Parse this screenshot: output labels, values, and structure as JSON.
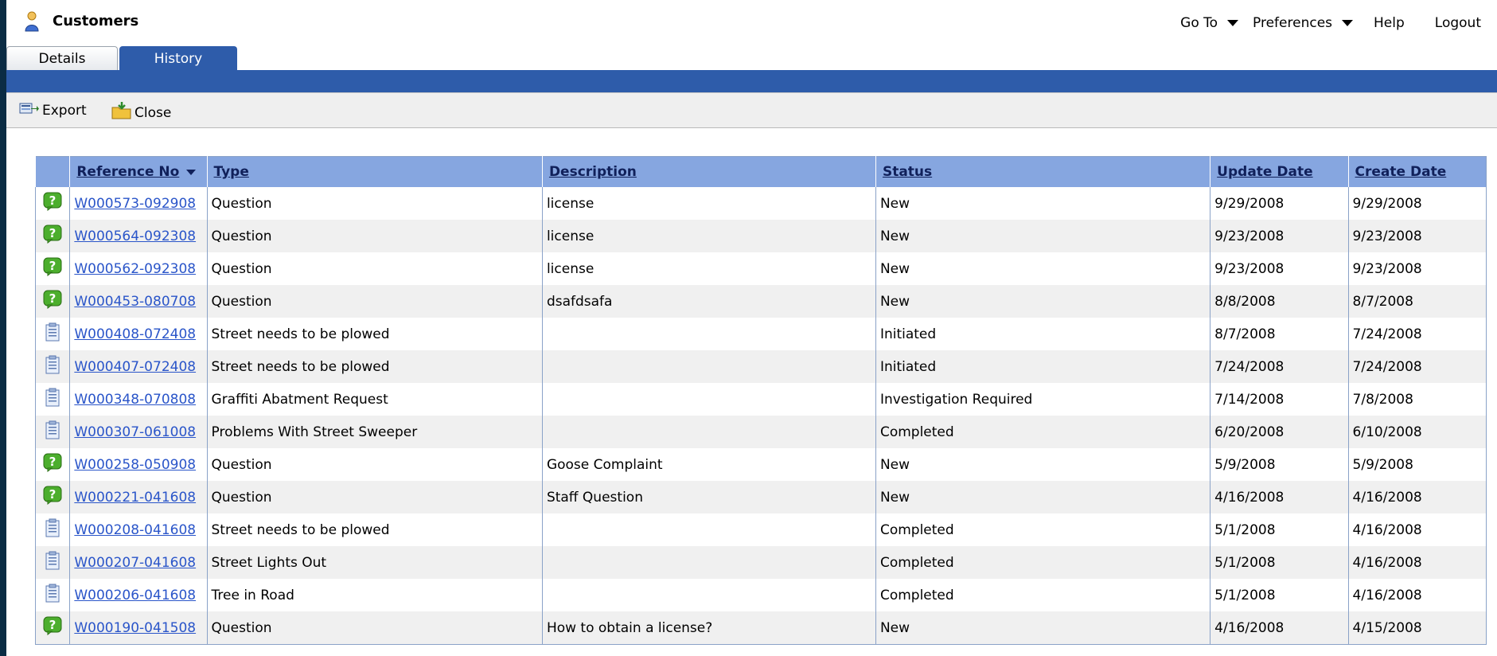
{
  "app": {
    "title": "Customers",
    "icon": "person-icon"
  },
  "topnav": {
    "goto": "Go To",
    "preferences": "Preferences",
    "help": "Help",
    "logout": "Logout"
  },
  "tabs": {
    "details": "Details",
    "history": "History"
  },
  "toolbar": {
    "export": "Export",
    "close": "Close"
  },
  "table": {
    "columns": {
      "reference": "Reference No",
      "type": "Type",
      "description": "Description",
      "status": "Status",
      "update_date": "Update Date",
      "create_date": "Create Date"
    },
    "sort": {
      "column": "reference",
      "direction": "descending"
    },
    "rows": [
      {
        "icon": "question-icon",
        "ref": "W000573-092908",
        "type": "Question",
        "description": "license",
        "status": "New",
        "update": "9/29/2008",
        "create": "9/29/2008"
      },
      {
        "icon": "question-icon",
        "ref": "W000564-092308",
        "type": "Question",
        "description": "license",
        "status": "New",
        "update": "9/23/2008",
        "create": "9/23/2008"
      },
      {
        "icon": "question-icon",
        "ref": "W000562-092308",
        "type": "Question",
        "description": "license",
        "status": "New",
        "update": "9/23/2008",
        "create": "9/23/2008"
      },
      {
        "icon": "question-icon",
        "ref": "W000453-080708",
        "type": "Question",
        "description": "dsafdsafa",
        "status": "New",
        "update": "8/8/2008",
        "create": "8/7/2008"
      },
      {
        "icon": "document-icon",
        "ref": "W000408-072408",
        "type": "Street needs to be plowed",
        "description": "",
        "status": "Initiated",
        "update": "8/7/2008",
        "create": "7/24/2008"
      },
      {
        "icon": "document-icon",
        "ref": "W000407-072408",
        "type": "Street needs to be plowed",
        "description": "",
        "status": "Initiated",
        "update": "7/24/2008",
        "create": "7/24/2008"
      },
      {
        "icon": "document-icon",
        "ref": "W000348-070808",
        "type": "Graffiti Abatment Request",
        "description": "",
        "status": "Investigation Required",
        "update": "7/14/2008",
        "create": "7/8/2008"
      },
      {
        "icon": "document-icon",
        "ref": "W000307-061008",
        "type": "Problems With Street Sweeper",
        "description": "",
        "status": "Completed",
        "update": "6/20/2008",
        "create": "6/10/2008"
      },
      {
        "icon": "question-icon",
        "ref": "W000258-050908",
        "type": "Question",
        "description": "Goose Complaint",
        "status": "New",
        "update": "5/9/2008",
        "create": "5/9/2008"
      },
      {
        "icon": "question-icon",
        "ref": "W000221-041608",
        "type": "Question",
        "description": "Staff Question",
        "status": "New",
        "update": "4/16/2008",
        "create": "4/16/2008"
      },
      {
        "icon": "document-icon",
        "ref": "W000208-041608",
        "type": "Street needs to be plowed",
        "description": "",
        "status": "Completed",
        "update": "5/1/2008",
        "create": "4/16/2008"
      },
      {
        "icon": "document-icon",
        "ref": "W000207-041608",
        "type": "Street Lights Out",
        "description": "",
        "status": "Completed",
        "update": "5/1/2008",
        "create": "4/16/2008"
      },
      {
        "icon": "document-icon",
        "ref": "W000206-041608",
        "type": "Tree in Road",
        "description": "",
        "status": "Completed",
        "update": "5/1/2008",
        "create": "4/16/2008"
      },
      {
        "icon": "question-icon",
        "ref": "W000190-041508",
        "type": "Question",
        "description": "How to obtain a license?",
        "status": "New",
        "update": "4/16/2008",
        "create": "4/15/2008"
      }
    ]
  },
  "colors": {
    "accent_blue": "#2e5caa",
    "header_blue": "#86a6e0",
    "link": "#2a55c9",
    "frame": "#0b2c44"
  }
}
